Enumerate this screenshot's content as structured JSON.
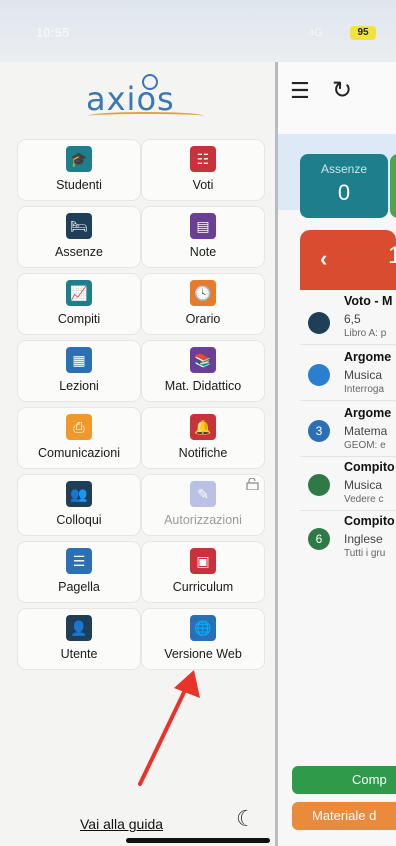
{
  "statusbar": {
    "time": "10:55",
    "network": "4G",
    "battery": "95"
  },
  "sidebar": {
    "logo_text": "axios",
    "items": [
      {
        "label": "Studenti",
        "icon": "student-icon",
        "color": "#1d7f8c"
      },
      {
        "label": "Voti",
        "icon": "grades-icon",
        "color": "#c8323a"
      },
      {
        "label": "Assenze",
        "icon": "absence-bed-icon",
        "color": "#1f3e58"
      },
      {
        "label": "Note",
        "icon": "note-icon",
        "color": "#6b3e98"
      },
      {
        "label": "Compiti",
        "icon": "homework-chart-icon",
        "color": "#1d7f8c"
      },
      {
        "label": "Orario",
        "icon": "clock-icon",
        "color": "#e87a2c"
      },
      {
        "label": "Lezioni",
        "icon": "lessons-icon",
        "color": "#2b6fb5"
      },
      {
        "label": "Mat. Didattico",
        "icon": "books-icon",
        "color": "#6b3e98"
      },
      {
        "label": "Comunicazioni",
        "icon": "pdf-document-icon",
        "color": "#f0992b"
      },
      {
        "label": "Notifiche",
        "icon": "bell-icon",
        "color": "#c8323a"
      },
      {
        "label": "Colloqui",
        "icon": "meeting-people-icon",
        "color": "#1f3e58"
      },
      {
        "label": "Autorizzazioni",
        "icon": "authorization-icon",
        "color": "#6a7fd0"
      },
      {
        "label": "Pagella",
        "icon": "report-card-icon",
        "color": "#2b6fb5"
      },
      {
        "label": "Curriculum",
        "icon": "curriculum-icon",
        "color": "#c8323a"
      },
      {
        "label": "Utente",
        "icon": "user-icon",
        "color": "#1f3e58"
      },
      {
        "label": "Versione Web",
        "icon": "globe-icon",
        "color": "#2b6fb5"
      }
    ],
    "guide_link": "Vai alla guida"
  },
  "main": {
    "cards": {
      "assenze_label": "Assenze",
      "assenze_value": "0"
    },
    "day_number": "1",
    "list": [
      {
        "title": "Voto - M",
        "line2": "6,5",
        "line3": "Libro A: p",
        "badge": "",
        "dot_color": "#1f3e58"
      },
      {
        "title": "Argome",
        "line2": "Musica",
        "line3": "Interroga",
        "badge": "",
        "dot_color": "#2b7fd0"
      },
      {
        "title": "Argome",
        "line2": "Matema",
        "line3": "GEOM: e",
        "badge": "3",
        "dot_color": "#2b6fb5"
      },
      {
        "title": "Compito",
        "line2": "Musica",
        "line3": "Vedere c",
        "badge": "",
        "dot_color": "#2d7a46"
      },
      {
        "title": "Compito",
        "line2": "Inglese",
        "line3": "Tutti i gru",
        "badge": "6",
        "dot_color": "#2d7a46"
      }
    ],
    "button_compiti": "Comp",
    "button_materiale": "Materiale d"
  }
}
